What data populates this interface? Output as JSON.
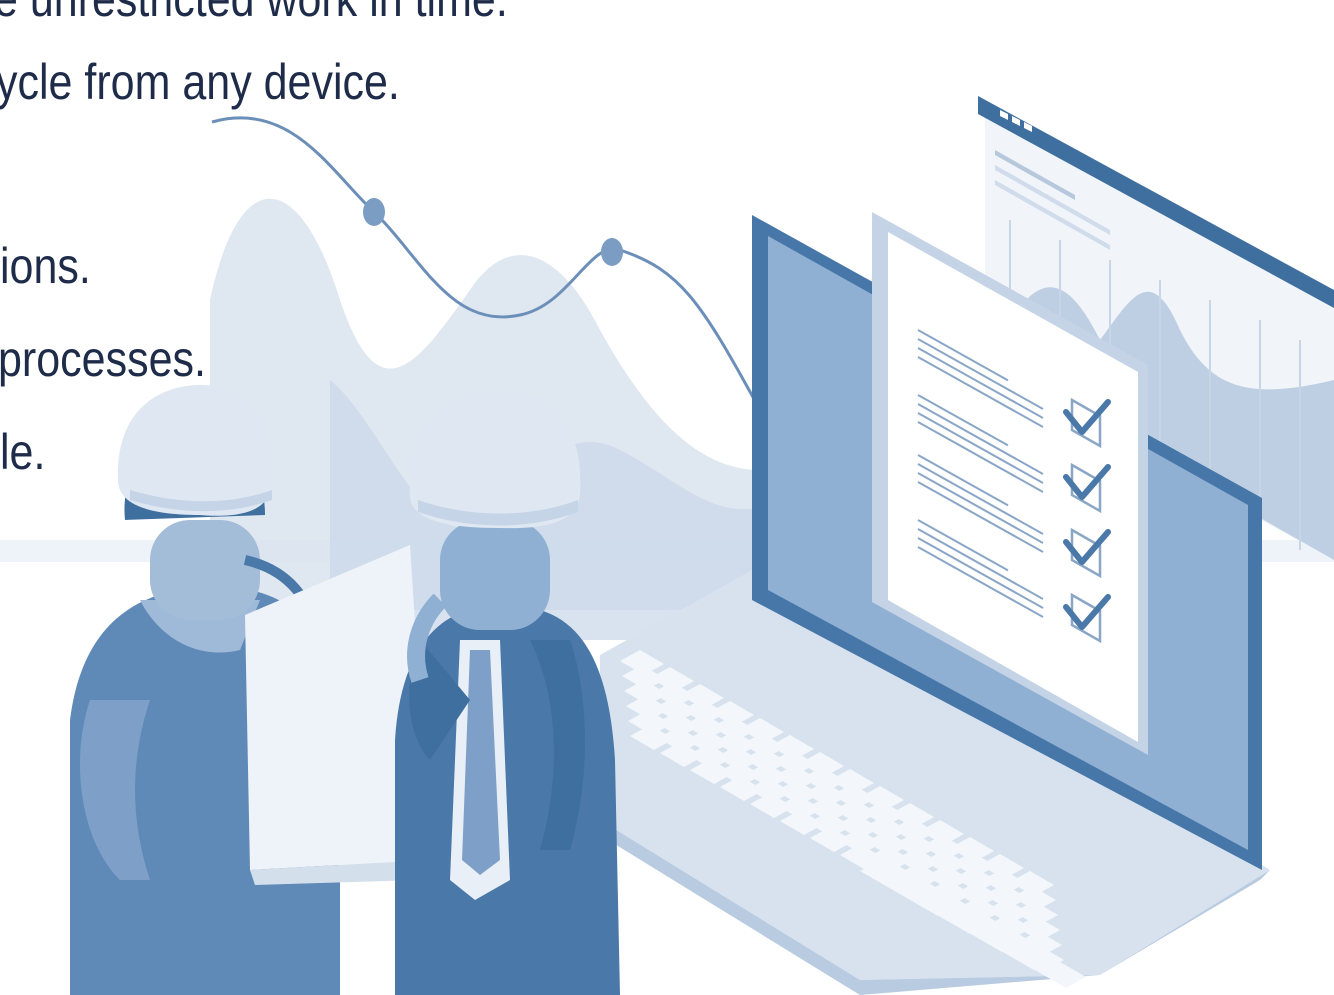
{
  "text_lines": [
    "e unrestricted work in time.",
    "ycle from any device.",
    "ions.",
    "processes.",
    "le."
  ],
  "illustration": {
    "icons": [
      "hard-hat-icon",
      "checkmark-icon",
      "laptop-icon",
      "document-icon",
      "wave-chart-icon"
    ],
    "colors": {
      "primary": "#4a78a8",
      "dark": "#3e6f9f",
      "light": "#c9d7e8",
      "pale": "#e6edf5",
      "text": "#1e2c4a"
    }
  }
}
